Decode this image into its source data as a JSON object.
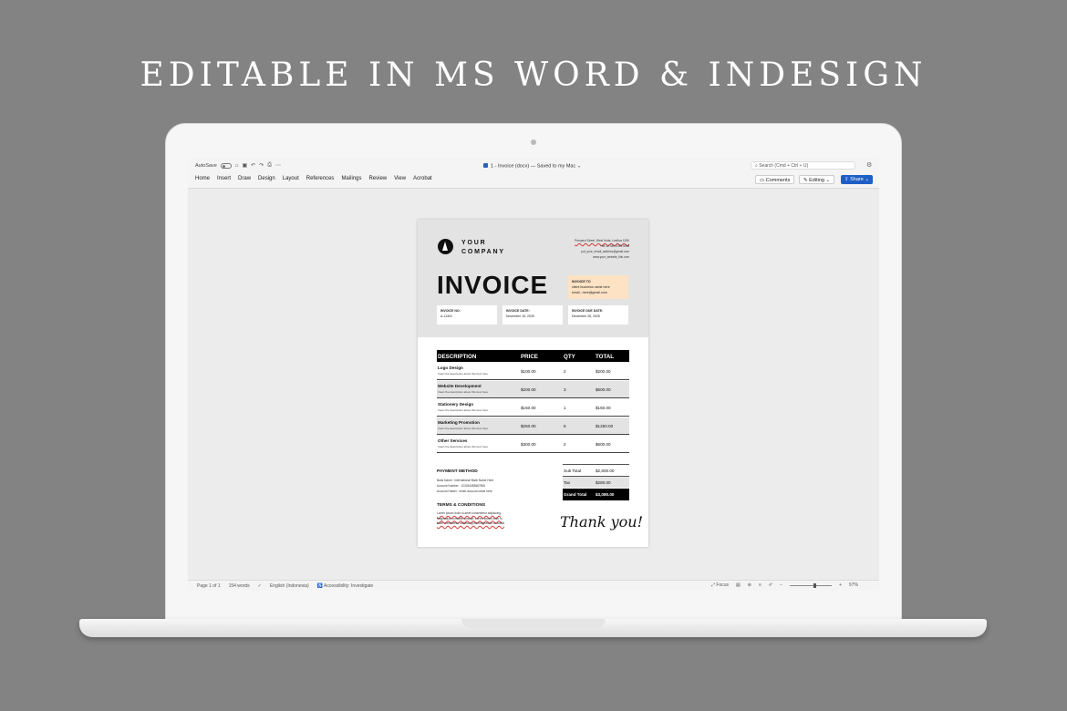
{
  "headline": "EDITABLE IN MS WORD & INDESIGN",
  "word": {
    "autosave_label": "AutoSave",
    "doc_title": "1 - Invoice (docx) — Saved to my Mac ⌄",
    "search_placeholder": "Search (Cmd + Ctrl + U)",
    "menu": [
      "Home",
      "Insert",
      "Draw",
      "Design",
      "Layout",
      "References",
      "Mailings",
      "Review",
      "View",
      "Acrobat"
    ],
    "comments_label": "Comments",
    "editing_label": "Editing ⌄",
    "share_label": "Share ⌄",
    "status": {
      "page": "Page 1 of 1",
      "words": "154 words",
      "language": "English (Indonesia)",
      "accessibility": "Accessibility: Investigate",
      "focus": "Focus",
      "zoom_minus": "−",
      "zoom_plus": "+",
      "zoom": "97%"
    }
  },
  "invoice": {
    "company_line1": "YOUR",
    "company_line2": "COMPANY",
    "address_lines": [
      "Prespect Street, West Kutta, Lesflow 1530",
      "+66 12 345 6789 0098",
      "put_your_email_address@gmail.com",
      "www.your_website_link.com"
    ],
    "title": "INVOICE",
    "invoice_to_label": "INVOICE TO",
    "client_name": "client business name here",
    "client_email": "email...here@gmail.com",
    "meta": [
      {
        "label": "INVOICE NO:",
        "value": "A-11301"
      },
      {
        "label": "INVOICE DATE:",
        "value": "November 15, 2025"
      },
      {
        "label": "INVOICE DUE DATE:",
        "value": "December 28, 2025"
      }
    ],
    "columns": [
      "DESCRIPTION",
      "PRICE",
      "QTY",
      "TOTAL"
    ],
    "rows": [
      {
        "service": "Logo Design",
        "desc": "Insert the description about this item here",
        "price": "$100.00",
        "qty": "2",
        "total": "$200.00"
      },
      {
        "service": "Website Development",
        "desc": "Insert the description about this item here",
        "price": "$200.00",
        "qty": "3",
        "total": "$600.00"
      },
      {
        "service": "Stationery Design",
        "desc": "Insert the description about this item here",
        "price": "$150.00",
        "qty": "1",
        "total": "$150.00"
      },
      {
        "service": "Marketing Promotion",
        "desc": "Insert the description about this item here",
        "price": "$250.00",
        "qty": "5",
        "total": "$1250.00"
      },
      {
        "service": "Other Services",
        "desc": "Insert the description about this item here",
        "price": "$300.00",
        "qty": "2",
        "total": "$600.00"
      }
    ],
    "payment_title": "PAYMENT METHOD",
    "payment_lines": [
      "Bank Name : International Bank Name Here",
      "Account Number : 123334455667890",
      "Account Holder : Insert account name here"
    ],
    "terms_title": "TERMS & CONDITIONS",
    "terms_lines": [
      "Lorem ipsum dolor si amet consectetur adipiscing",
      "magnaduis convallis suscipit. Lorem ipsum dolor si",
      "amet consectetur adipiscing elit magnaduis convallis"
    ],
    "subtotal_label": "Sub Total",
    "subtotal_value": "$2,800.00",
    "tax_label": "Tax",
    "tax_value": "$280.00",
    "grand_label": "Grand Total",
    "grand_value": "$3,080.00",
    "thank_you": "Thank you!"
  }
}
